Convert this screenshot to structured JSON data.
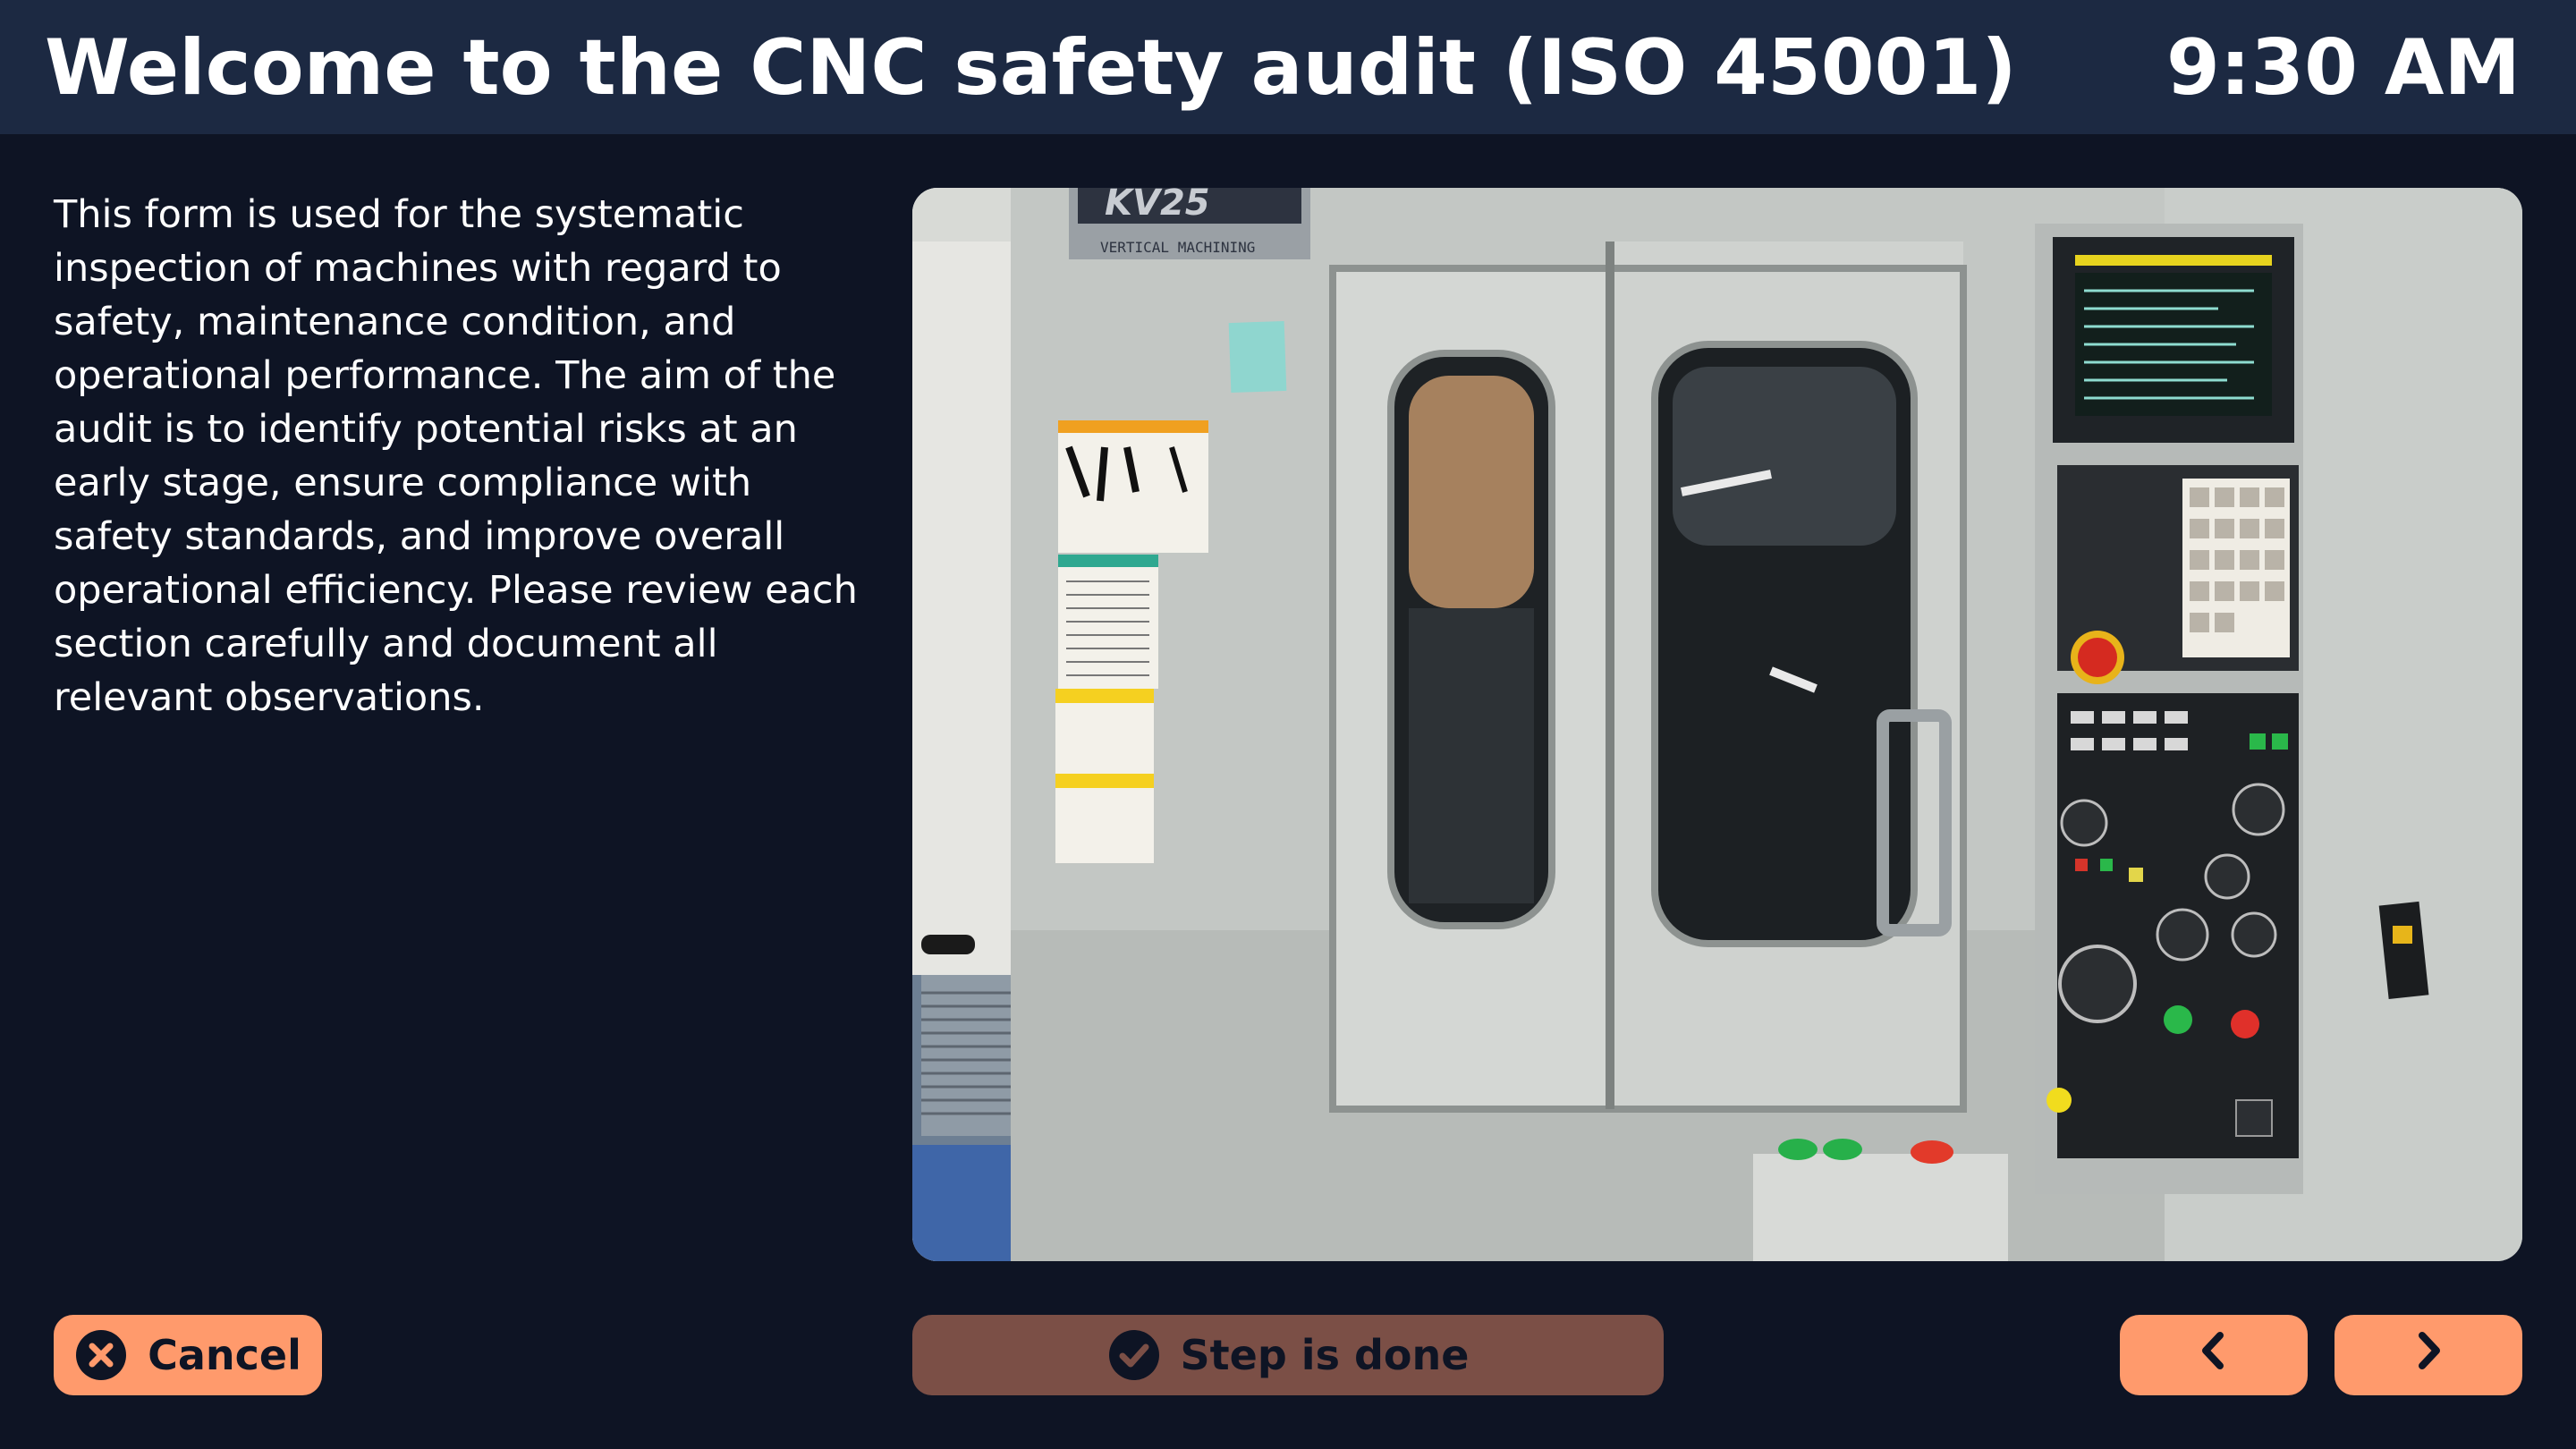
{
  "header": {
    "title": "Welcome to the CNC safety audit (ISO 45001)",
    "time": "9:30 AM"
  },
  "main": {
    "description": "This form is used for the systematic inspection of machines with regard to safety, maintenance condition, and operational performance. The aim of the audit is to identify potential risks at an early stage, ensure compliance with safety standards, and improve overall operational efficiency. Please review each section carefully and document all relevant observations.",
    "photo": {
      "subject": "CNC vertical machining center with control panel",
      "machine_label": "KV25",
      "machine_sublabel": "VERTICAL MACHINING CENTER"
    }
  },
  "footer": {
    "cancel_label": "Cancel",
    "step_done_label": "Step is done",
    "prev_icon": "chevron-left-icon",
    "next_icon": "chevron-right-icon"
  },
  "colors": {
    "background": "#0e1424",
    "header": "#1c2942",
    "accent": "#ff9a6c",
    "done_button": "#7b4f46",
    "text": "#ffffff"
  }
}
